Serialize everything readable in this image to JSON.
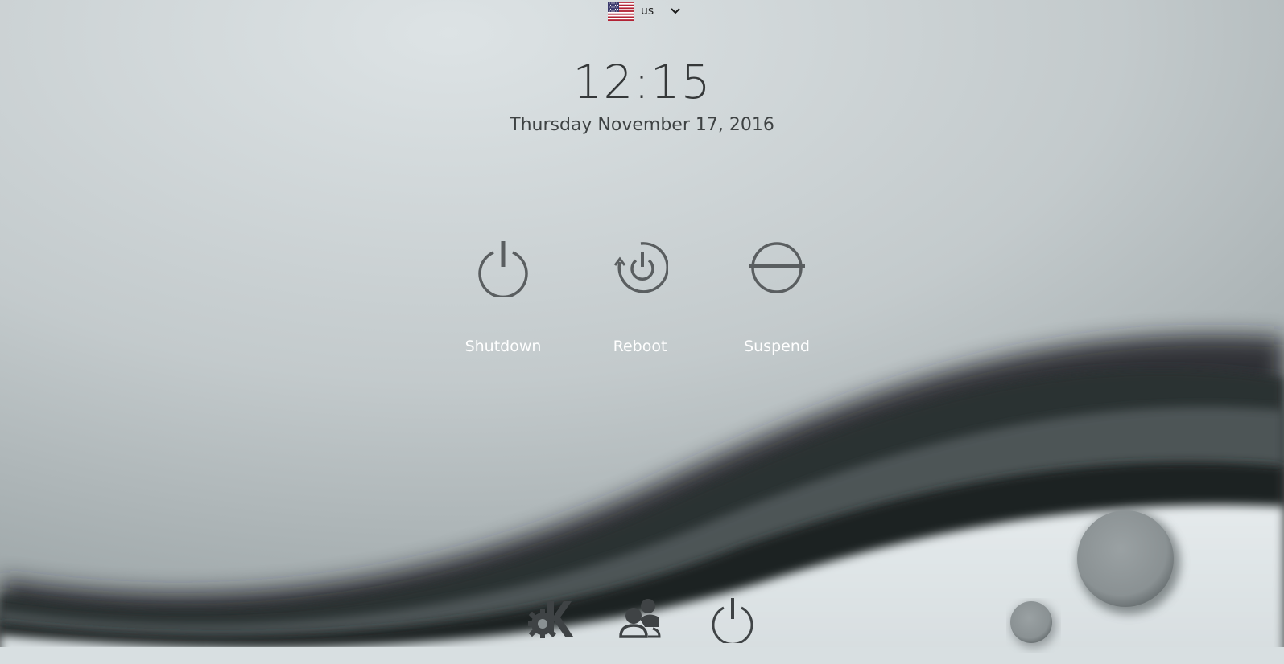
{
  "keyboard_layout": {
    "label": "us",
    "flag_icon": "us-flag-icon",
    "dropdown_icon": "chevron-down-icon"
  },
  "clock": {
    "time": "12:15",
    "date": "Thursday November 17, 2016"
  },
  "actions": [
    {
      "label": "Shutdown",
      "icon": "power-icon"
    },
    {
      "label": "Reboot",
      "icon": "reboot-icon"
    },
    {
      "label": "Suspend",
      "icon": "suspend-icon"
    }
  ],
  "bottom_bar": [
    {
      "icon": "kde-logo-icon"
    },
    {
      "icon": "switch-user-icon"
    },
    {
      "icon": "power-icon"
    }
  ],
  "colors": {
    "icon_gray": "#5a5e60",
    "label_white": "#ffffff",
    "text_dark": "#353839"
  }
}
